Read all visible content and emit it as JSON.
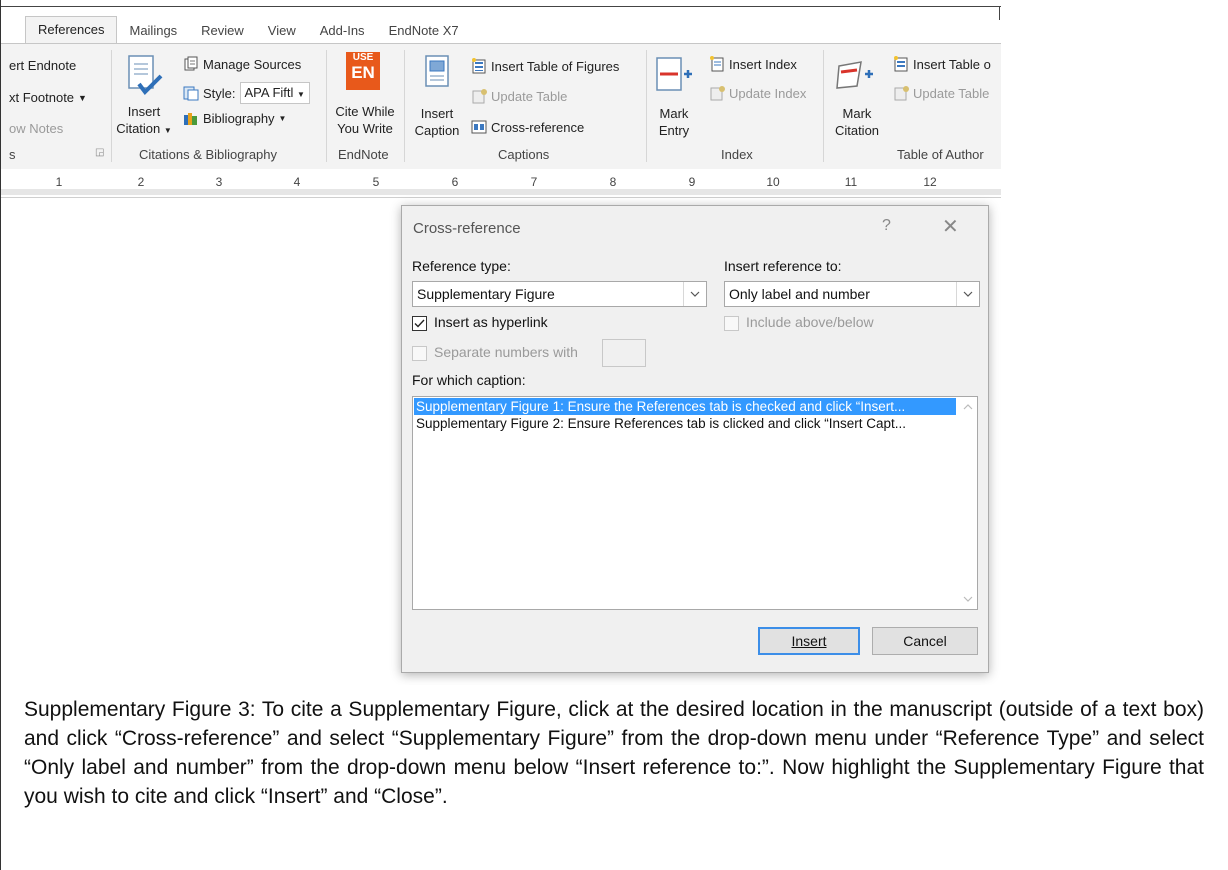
{
  "tabs": [
    "References",
    "Mailings",
    "Review",
    "View",
    "Add-Ins",
    "EndNote X7"
  ],
  "ribbon": {
    "footnotes": {
      "insert_endnote": "ert Endnote",
      "next_footnote": "xt Footnote",
      "show_notes": "ow Notes",
      "group_label": "s"
    },
    "citations": {
      "insert_citation_line1": "Insert",
      "insert_citation_line2": "Citation",
      "manage_sources": "Manage Sources",
      "style_label": "Style:",
      "style_value": "APA Fiftl",
      "bibliography": "Bibliography",
      "group_label": "Citations & Bibliography"
    },
    "endnote": {
      "logo_top": "USE",
      "logo_bottom": "EN",
      "cite_line1": "Cite While",
      "cite_line2": "You Write",
      "group_label": "EndNote"
    },
    "captions": {
      "insert_caption_line1": "Insert",
      "insert_caption_line2": "Caption",
      "insert_table_of_figures": "Insert Table of Figures",
      "update_table": "Update Table",
      "cross_reference": "Cross-reference",
      "group_label": "Captions"
    },
    "index": {
      "mark_entry_line1": "Mark",
      "mark_entry_line2": "Entry",
      "insert_index": "Insert Index",
      "update_index": "Update Index",
      "group_label": "Index"
    },
    "toa": {
      "mark_citation_line1": "Mark",
      "mark_citation_line2": "Citation",
      "insert_table": "Insert Table o",
      "update_table": "Update Table",
      "group_label": "Table of Author"
    }
  },
  "ruler": {
    "numbers": [
      "1",
      "2",
      "3",
      "4",
      "5",
      "6",
      "7",
      "8",
      "9",
      "10",
      "11",
      "12"
    ]
  },
  "dialog": {
    "title": "Cross-reference",
    "help": "?",
    "close": "✕",
    "reference_type_label": "Reference type:",
    "reference_type_value": "Supplementary Figure",
    "insert_reference_label": "Insert reference to:",
    "insert_reference_value": "Only label and number",
    "insert_as_hyperlink": "Insert as hyperlink",
    "include_above_below": "Include above/below",
    "separate_numbers": "Separate numbers with",
    "for_which_caption": "For which caption:",
    "captions": [
      "Supplementary Figure 1: Ensure the References tab is checked and click “Insert...",
      "Supplementary Figure 2: Ensure References tab is clicked and click “Insert Capt..."
    ],
    "insert_button": "Insert",
    "cancel_button": "Cancel"
  },
  "figure_caption": "Supplementary Figure 3: To cite a Supplementary Figure, click at the desired location in the manuscript (outside of a text box) and click “Cross-reference” and select “Supplementary Figure” from the drop-down menu under “Reference Type” and select “Only label and number” from the drop-down menu below “Insert reference to:”. Now highlight the Supplementary Figure that you wish to cite and click “Insert” and “Close”.",
  "colors": {
    "ribbon_bg": "#f3f3f3",
    "selection": "#3399ff",
    "endnote_orange": "#e8591b",
    "primary_border": "#3c8ee8"
  }
}
